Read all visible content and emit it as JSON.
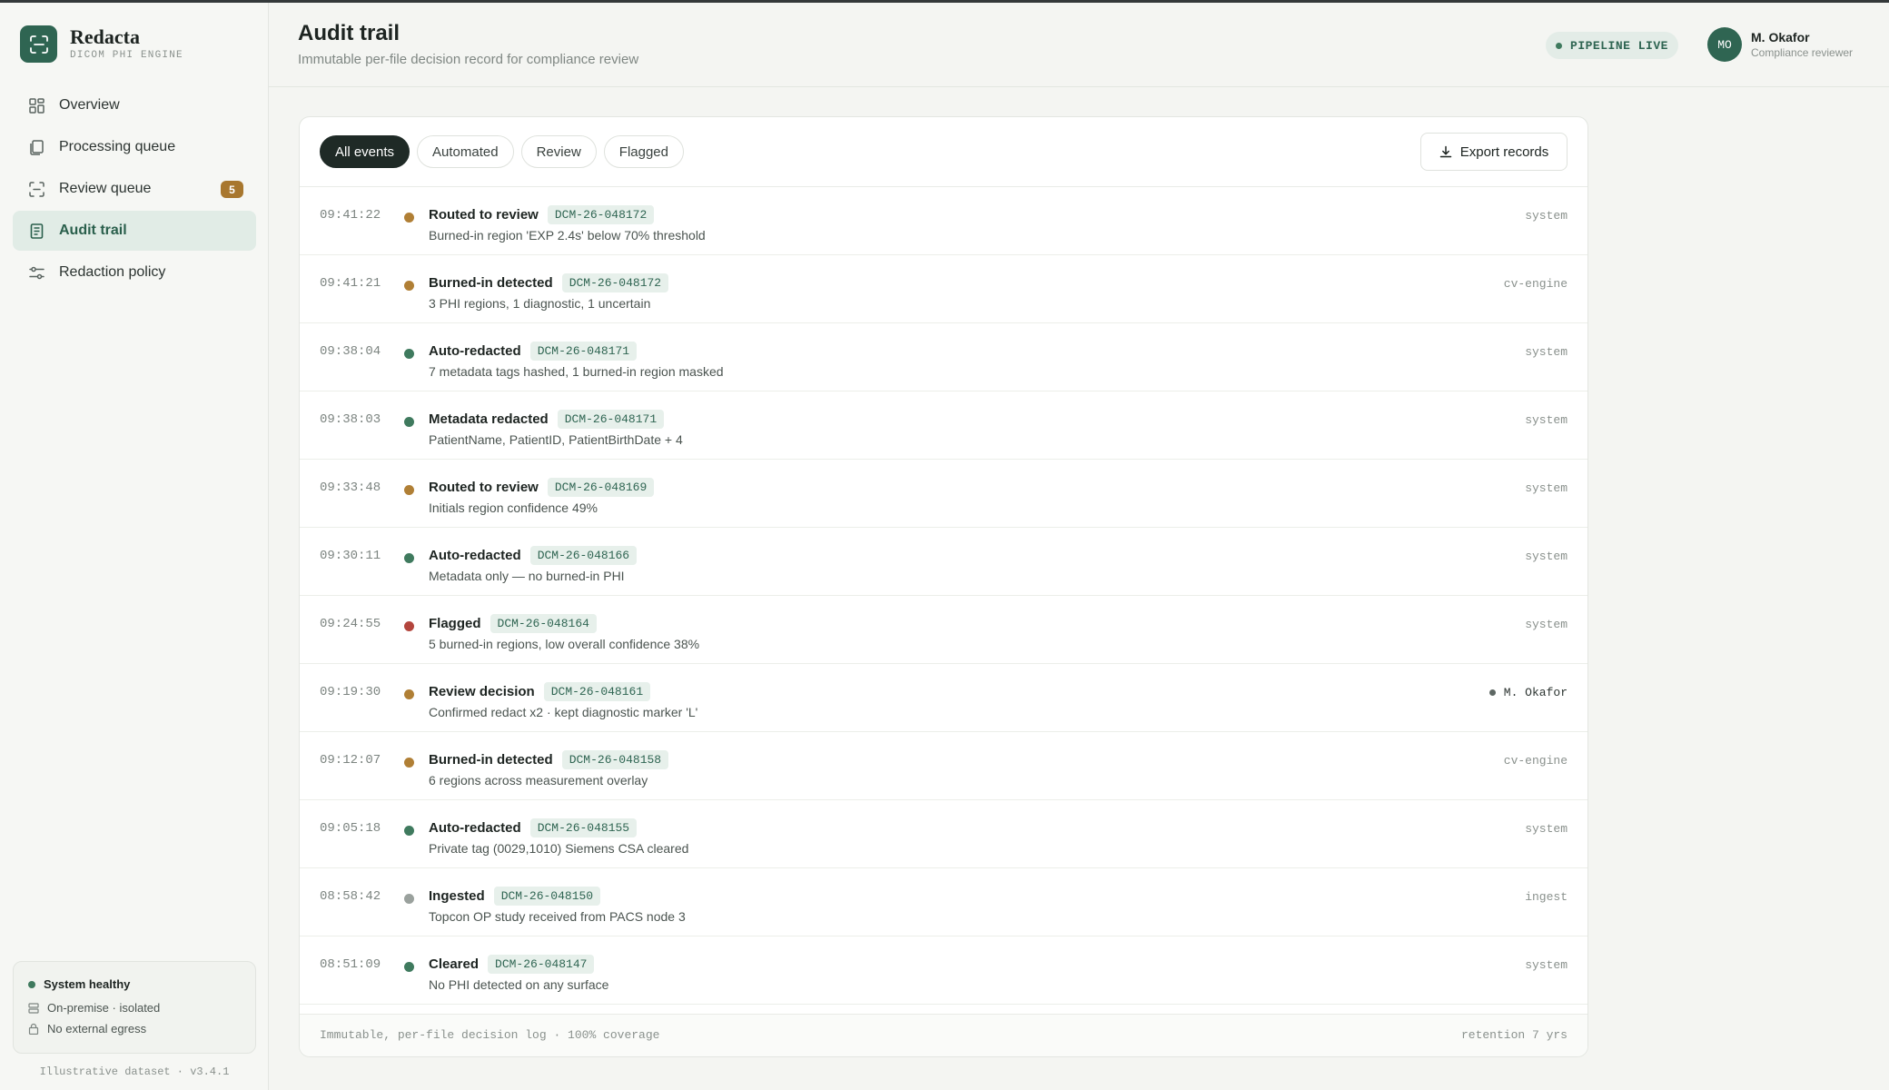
{
  "app": {
    "name": "Redacta",
    "tagline": "DICOM PHI ENGINE",
    "version": "Illustrative dataset · v3.4.1"
  },
  "sidebar": {
    "items": [
      {
        "label": "Overview",
        "icon": "grid-icon"
      },
      {
        "label": "Processing queue",
        "icon": "stack-icon"
      },
      {
        "label": "Review queue",
        "icon": "scan-icon",
        "badge": "5"
      },
      {
        "label": "Audit trail",
        "icon": "document-icon",
        "active": true
      },
      {
        "label": "Redaction policy",
        "icon": "sliders-icon"
      }
    ],
    "status": {
      "title": "System healthy",
      "line1": "On-premise · isolated",
      "line2": "No external egress"
    }
  },
  "header": {
    "title": "Audit trail",
    "subtitle": "Immutable per-file decision record for compliance review",
    "pipeline": "PIPELINE LIVE",
    "user": {
      "initials": "MO",
      "name": "M. Okafor",
      "role": "Compliance reviewer"
    }
  },
  "filters": [
    "All events",
    "Automated",
    "Review",
    "Flagged"
  ],
  "active_filter": "All events",
  "export_label": "Export records",
  "colors": {
    "review": "#b07f35",
    "ok": "#3f7a5e",
    "flagged": "#b3453d",
    "neutral": "#9aa19d"
  },
  "events": [
    {
      "time": "09:41:22",
      "status": "review",
      "title": "Routed to review",
      "file": "DCM-26-048172",
      "detail": "Burned-in region 'EXP 2.4s' below 70% threshold",
      "actor": "system"
    },
    {
      "time": "09:41:21",
      "status": "review",
      "title": "Burned-in detected",
      "file": "DCM-26-048172",
      "detail": "3 PHI regions, 1 diagnostic, 1 uncertain",
      "actor": "cv-engine"
    },
    {
      "time": "09:38:04",
      "status": "ok",
      "title": "Auto-redacted",
      "file": "DCM-26-048171",
      "detail": "7 metadata tags hashed, 1 burned-in region masked",
      "actor": "system"
    },
    {
      "time": "09:38:03",
      "status": "ok",
      "title": "Metadata redacted",
      "file": "DCM-26-048171",
      "detail": "PatientName, PatientID, PatientBirthDate + 4",
      "actor": "system"
    },
    {
      "time": "09:33:48",
      "status": "review",
      "title": "Routed to review",
      "file": "DCM-26-048169",
      "detail": "Initials region confidence 49%",
      "actor": "system"
    },
    {
      "time": "09:30:11",
      "status": "ok",
      "title": "Auto-redacted",
      "file": "DCM-26-048166",
      "detail": "Metadata only — no burned-in PHI",
      "actor": "system"
    },
    {
      "time": "09:24:55",
      "status": "flagged",
      "title": "Flagged",
      "file": "DCM-26-048164",
      "detail": "5 burned-in regions, low overall confidence 38%",
      "actor": "system"
    },
    {
      "time": "09:19:30",
      "status": "review",
      "title": "Review decision",
      "file": "DCM-26-048161",
      "detail": "Confirmed redact x2 · kept diagnostic marker 'L'",
      "actor": "M. Okafor",
      "human": true
    },
    {
      "time": "09:12:07",
      "status": "review",
      "title": "Burned-in detected",
      "file": "DCM-26-048158",
      "detail": "6 regions across measurement overlay",
      "actor": "cv-engine"
    },
    {
      "time": "09:05:18",
      "status": "ok",
      "title": "Auto-redacted",
      "file": "DCM-26-048155",
      "detail": "Private tag (0029,1010) Siemens CSA cleared",
      "actor": "system"
    },
    {
      "time": "08:58:42",
      "status": "neutral",
      "title": "Ingested",
      "file": "DCM-26-048150",
      "detail": "Topcon OP study received from PACS node 3",
      "actor": "ingest"
    },
    {
      "time": "08:51:09",
      "status": "ok",
      "title": "Cleared",
      "file": "DCM-26-048147",
      "detail": "No PHI detected on any surface",
      "actor": "system"
    }
  ],
  "footer": {
    "left": "Immutable, per-file decision log · 100% coverage",
    "right": "retention 7 yrs"
  }
}
